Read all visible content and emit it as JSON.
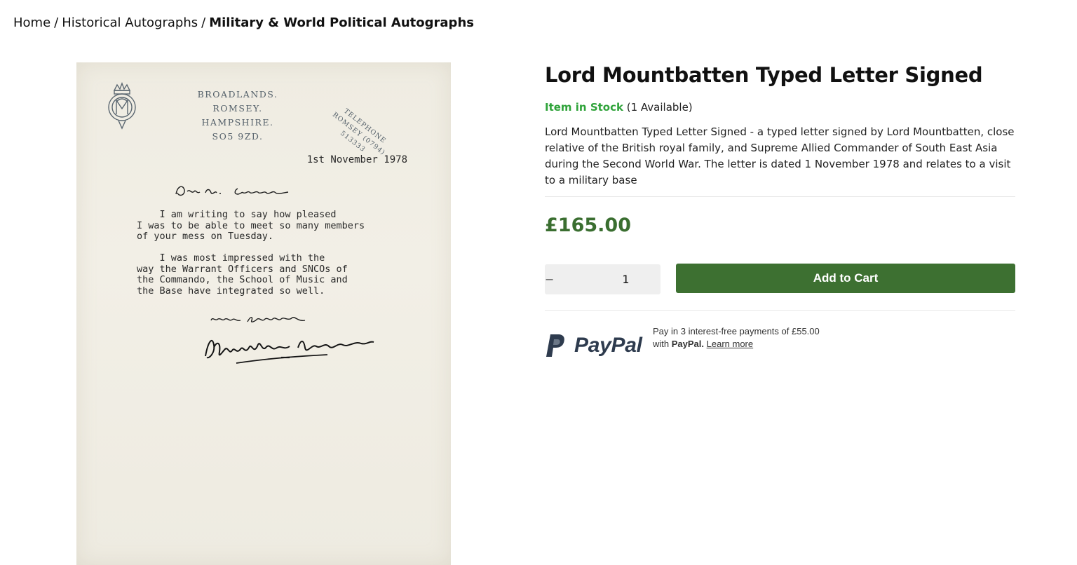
{
  "breadcrumb": {
    "home": "Home",
    "separator": "/",
    "category": "Historical Autographs",
    "current": "Military & World Political Autographs"
  },
  "letter": {
    "address_lines": [
      "BROADLANDS.",
      "ROMSEY.",
      "HAMPSHIRE.",
      "SO5 9ZD."
    ],
    "phone_lines": [
      "TELEPHONE",
      "ROMSEY (0794) 513333"
    ],
    "date": "1st November 1978",
    "body": "    I am writing to say how pleased\nI was to be able to meet so many members\nof your mess on Tuesday.\n\n    I was most impressed with the\nway the Warrant Officers and SNCOs of\nthe Commando, the School of Music and\nthe Base have integrated so well."
  },
  "product": {
    "title": "Lord Mountbatten Typed Letter Signed",
    "stock_status": "Item in Stock",
    "stock_count": "(1 Available)",
    "description": "Lord Mountbatten Typed Letter Signed - a typed letter signed by Lord Mountbatten, close relative of the British royal family, and Supreme Allied Commander of South East Asia during the Second World War. The letter is dated 1 November 1978 and relates to a visit to a military base",
    "price": "£165.00"
  },
  "cart": {
    "decrement": "−",
    "quantity": "1",
    "increment": "+",
    "add_label": "Add to Cart"
  },
  "paypal": {
    "logo_text": "PayPal",
    "line1": "Pay in 3 interest-free payments of £55.00",
    "with": "with",
    "brand": "PayPal.",
    "learn_more": "Learn more"
  },
  "colors": {
    "accent_green": "#3d7031",
    "price_green": "#3a6e30",
    "stock_green": "#2fa33a",
    "paypal_navy": "#2e3b4e"
  }
}
